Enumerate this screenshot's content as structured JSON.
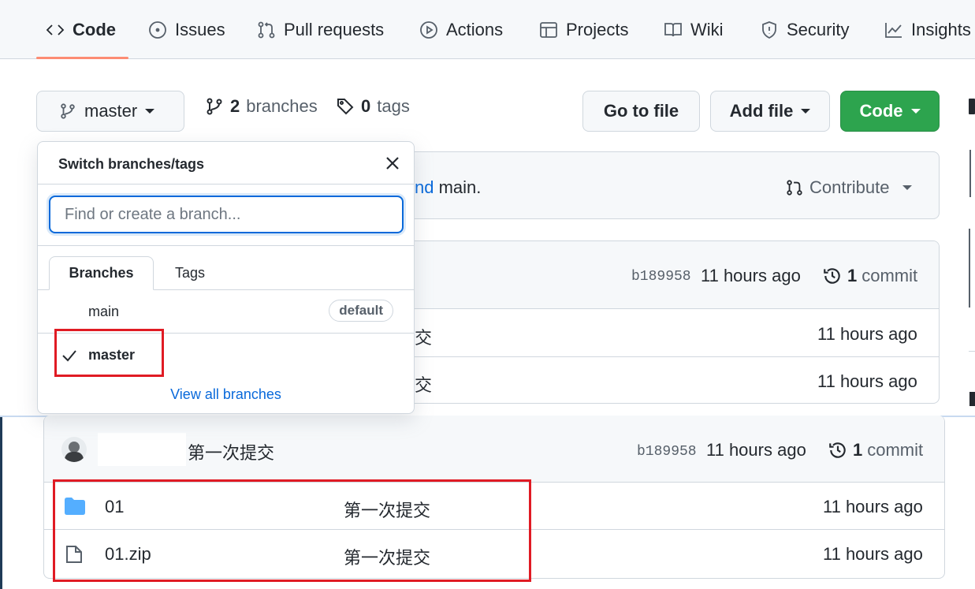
{
  "nav": {
    "tabs": [
      {
        "label": "Code",
        "icon": "code-icon"
      },
      {
        "label": "Issues",
        "icon": "issue-icon"
      },
      {
        "label": "Pull requests",
        "icon": "pull-request-icon"
      },
      {
        "label": "Actions",
        "icon": "play-icon"
      },
      {
        "label": "Projects",
        "icon": "table-icon"
      },
      {
        "label": "Wiki",
        "icon": "book-icon"
      },
      {
        "label": "Security",
        "icon": "shield-icon"
      },
      {
        "label": "Insights",
        "icon": "graph-icon"
      }
    ]
  },
  "toolbar": {
    "branch_label": "master",
    "branches_count": "2",
    "branches_label": "branches",
    "tags_count": "0",
    "tags_label": "tags",
    "goto_file": "Go to file",
    "add_file": "Add file",
    "code": "Code"
  },
  "banner": {
    "text_link": "nd",
    "text_rest": " main.",
    "contribute": "Contribute"
  },
  "commit_header_back": {
    "sha": "b189958",
    "time": "11 hours ago",
    "commit_count": "1",
    "commit_label": "commit"
  },
  "back_rows": [
    {
      "msg": "交",
      "time": "11 hours ago"
    },
    {
      "msg": "交",
      "time": "11 hours ago"
    }
  ],
  "dropdown": {
    "title": "Switch branches/tags",
    "input_placeholder": "Find or create a branch...",
    "tabs": [
      "Branches",
      "Tags"
    ],
    "branches": [
      {
        "name": "main",
        "badge": "default"
      },
      {
        "name": "master"
      }
    ],
    "view_all": "View all branches"
  },
  "commit_header": {
    "message": "第一次提交",
    "sha": "b189958",
    "time": "11 hours ago",
    "commit_count": "1",
    "commit_label": "commit"
  },
  "files": [
    {
      "name": "01",
      "type": "folder",
      "message": "第一次提交",
      "time": "11 hours ago"
    },
    {
      "name": "01.zip",
      "type": "file",
      "message": "第一次提交",
      "time": "11 hours ago"
    }
  ],
  "colors": {
    "accent": "#0969da",
    "primary_button": "#2da44e",
    "highlight_box": "#e01b24",
    "tab_underline": "#fd8c73"
  }
}
